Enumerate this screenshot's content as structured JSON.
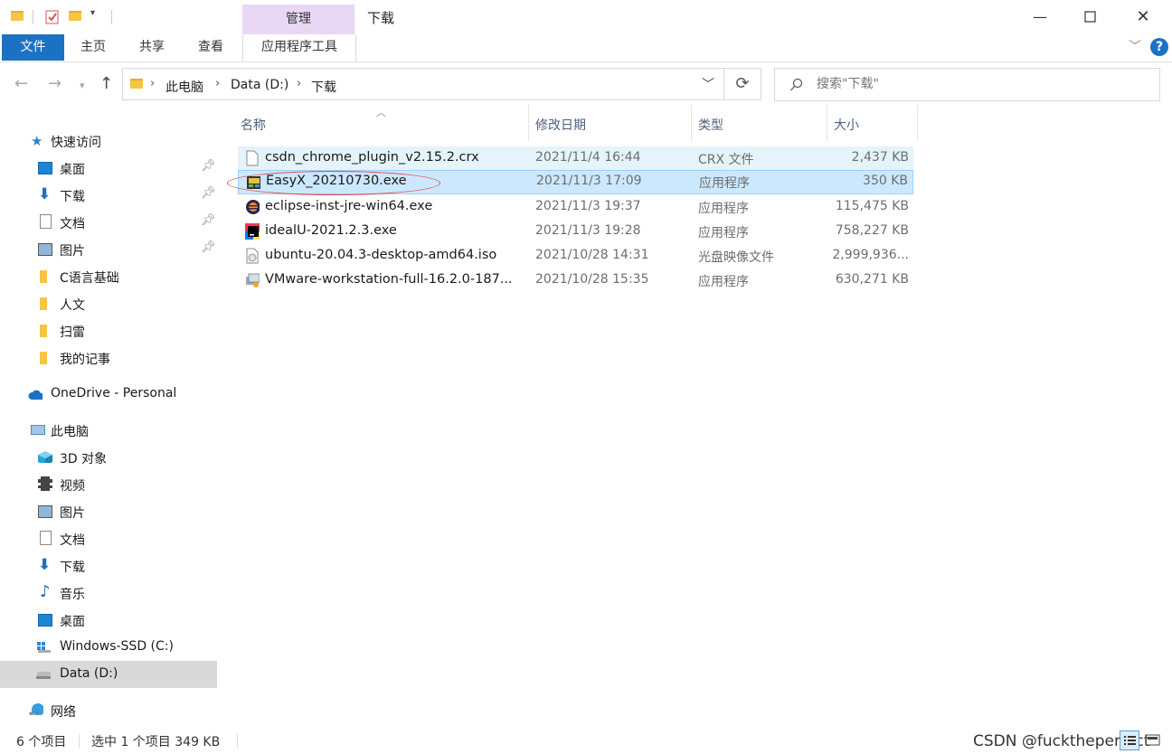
{
  "window": {
    "title": "下载",
    "manage_tab": "管理",
    "min_icon": "minimize-icon",
    "max_icon": "maximize-icon",
    "close_icon": "close-icon"
  },
  "ribbon": {
    "tabs": [
      "文件",
      "主页",
      "共享",
      "查看",
      "应用程序工具"
    ],
    "help": "?"
  },
  "address": {
    "crumbs": [
      "此电脑",
      "Data (D:)",
      "下载"
    ],
    "search_placeholder": "搜索\"下载\""
  },
  "nav": {
    "quick_access": "快速访问",
    "quick_items": [
      {
        "label": "桌面",
        "pinned": true
      },
      {
        "label": "下载",
        "pinned": true
      },
      {
        "label": "文档",
        "pinned": true
      },
      {
        "label": "图片",
        "pinned": true
      },
      {
        "label": "C语言基础",
        "pinned": false
      },
      {
        "label": "人文",
        "pinned": false
      },
      {
        "label": "扫雷",
        "pinned": false
      },
      {
        "label": "我的记事",
        "pinned": false
      }
    ],
    "onedrive": "OneDrive - Personal",
    "this_pc": "此电脑",
    "pc_items": [
      "3D 对象",
      "视频",
      "图片",
      "文档",
      "下载",
      "音乐",
      "桌面",
      "Windows-SSD (C:)",
      "Data (D:)"
    ],
    "network": "网络"
  },
  "columns": {
    "name": "名称",
    "date": "修改日期",
    "type": "类型",
    "size": "大小"
  },
  "files": [
    {
      "name": "csdn_chrome_plugin_v2.15.2.crx",
      "date": "2021/11/4 16:44",
      "type": "CRX 文件",
      "size": "2,437 KB",
      "icon": "blank-file-icon"
    },
    {
      "name": "EasyX_20210730.exe",
      "date": "2021/11/3 17:09",
      "type": "应用程序",
      "size": "350 KB",
      "icon": "easyx-installer-icon"
    },
    {
      "name": "eclipse-inst-jre-win64.exe",
      "date": "2021/11/3 19:37",
      "type": "应用程序",
      "size": "115,475 KB",
      "icon": "eclipse-icon"
    },
    {
      "name": "idealU-2021.2.3.exe",
      "date": "2021/11/3 19:28",
      "type": "应用程序",
      "size": "758,227 KB",
      "icon": "intellij-icon"
    },
    {
      "name": "ubuntu-20.04.3-desktop-amd64.iso",
      "date": "2021/10/28 14:31",
      "type": "光盘映像文件",
      "size": "2,999,936...",
      "icon": "disc-image-icon"
    },
    {
      "name": "VMware-workstation-full-16.2.0-187...",
      "date": "2021/10/28 15:35",
      "type": "应用程序",
      "size": "630,271 KB",
      "icon": "vmware-icon"
    }
  ],
  "status": {
    "count": "6 个项目",
    "selection": "选中 1 个项目  349 KB",
    "watermark": "CSDN @fucktheperfect"
  }
}
